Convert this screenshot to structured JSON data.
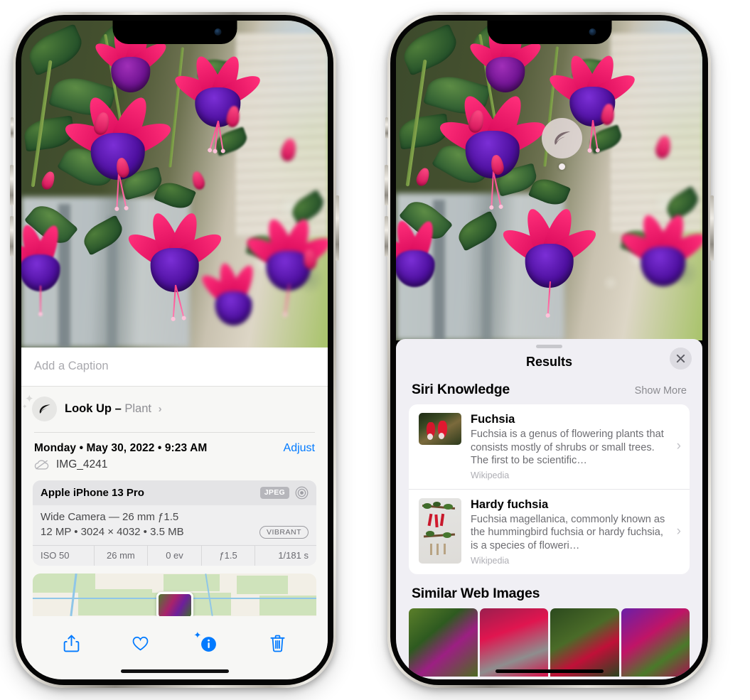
{
  "left_phone": {
    "photo_alt": "Fuchsia flowers hanging basket",
    "caption_placeholder": "Add a Caption",
    "lookup": {
      "icon": "leaf-icon",
      "label": "Look Up –",
      "subject": "Plant",
      "chevron": "›"
    },
    "date_line": "Monday • May 30, 2022 • 9:23 AM",
    "adjust_label": "Adjust",
    "file_icon": "cloud-slash-icon",
    "file_name": "IMG_4241",
    "camera_card": {
      "device": "Apple iPhone 13 Pro",
      "format_badge": "JPEG",
      "hdr_icon": "hdr-icon",
      "lens_line": "Wide Camera — 26 mm ƒ1.5",
      "spec_line": "12 MP • 3024 × 4032 • 3.5 MB",
      "style_badge": "VIBRANT",
      "exif": [
        "ISO 50",
        "26 mm",
        "0 ev",
        "ƒ1.5",
        "1/181 s"
      ]
    },
    "toolbar": [
      {
        "name": "share-icon",
        "label": "Share"
      },
      {
        "name": "favorite-icon",
        "label": "Favorite"
      },
      {
        "name": "info-icon",
        "label": "Info"
      },
      {
        "name": "trash-icon",
        "label": "Delete"
      }
    ],
    "accent_color": "#017aff"
  },
  "right_phone": {
    "lookup_badge": {
      "icon": "leaf-icon"
    },
    "sheet": {
      "title": "Results",
      "close_icon": "close-icon",
      "siri_section": {
        "title": "Siri Knowledge",
        "action": "Show More"
      },
      "results": [
        {
          "thumb": "fuchsia-red-thumb",
          "title": "Fuchsia",
          "snippet": "Fuchsia is a genus of flowering plants that consists mostly of shrubs or small trees. The first to be scientific…",
          "source": "Wikipedia",
          "chevron": "›"
        },
        {
          "thumb": "hardy-fuchsia-specimen-thumb",
          "title": "Hardy fuchsia",
          "snippet": "Fuchsia magellanica, commonly known as the hummingbird fuchsia or hardy fuchsia, is a species of floweri…",
          "source": "Wikipedia",
          "chevron": "›"
        }
      ],
      "web_section": {
        "title": "Similar Web Images"
      },
      "web_images": [
        {
          "name": "web-image-1"
        },
        {
          "name": "web-image-2"
        },
        {
          "name": "web-image-3"
        },
        {
          "name": "web-image-4"
        }
      ]
    }
  }
}
